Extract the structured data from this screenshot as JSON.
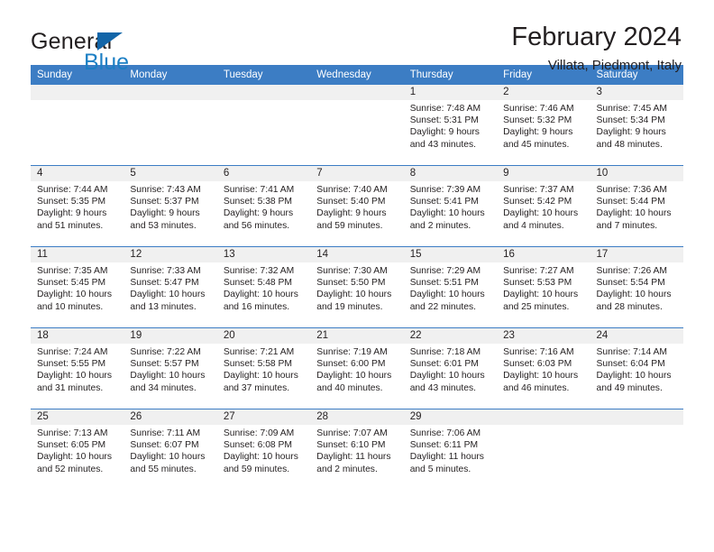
{
  "brand": {
    "name_top": "General",
    "name_bottom": "Blue"
  },
  "header": {
    "title": "February 2024",
    "location": "Villata, Piedmont, Italy"
  },
  "colors": {
    "header_blue": "#3c7dc4",
    "brand_blue": "#1c7fc4",
    "daynum_band": "#f0f0f0",
    "text": "#231f20"
  },
  "weekday_headers": [
    "Sunday",
    "Monday",
    "Tuesday",
    "Wednesday",
    "Thursday",
    "Friday",
    "Saturday"
  ],
  "weeks": [
    [
      {
        "day": "",
        "empty": true
      },
      {
        "day": "",
        "empty": true
      },
      {
        "day": "",
        "empty": true
      },
      {
        "day": "",
        "empty": true
      },
      {
        "day": "1",
        "sunrise": "Sunrise: 7:48 AM",
        "sunset": "Sunset: 5:31 PM",
        "daylight_1": "Daylight: 9 hours",
        "daylight_2": "and 43 minutes."
      },
      {
        "day": "2",
        "sunrise": "Sunrise: 7:46 AM",
        "sunset": "Sunset: 5:32 PM",
        "daylight_1": "Daylight: 9 hours",
        "daylight_2": "and 45 minutes."
      },
      {
        "day": "3",
        "sunrise": "Sunrise: 7:45 AM",
        "sunset": "Sunset: 5:34 PM",
        "daylight_1": "Daylight: 9 hours",
        "daylight_2": "and 48 minutes."
      }
    ],
    [
      {
        "day": "4",
        "sunrise": "Sunrise: 7:44 AM",
        "sunset": "Sunset: 5:35 PM",
        "daylight_1": "Daylight: 9 hours",
        "daylight_2": "and 51 minutes."
      },
      {
        "day": "5",
        "sunrise": "Sunrise: 7:43 AM",
        "sunset": "Sunset: 5:37 PM",
        "daylight_1": "Daylight: 9 hours",
        "daylight_2": "and 53 minutes."
      },
      {
        "day": "6",
        "sunrise": "Sunrise: 7:41 AM",
        "sunset": "Sunset: 5:38 PM",
        "daylight_1": "Daylight: 9 hours",
        "daylight_2": "and 56 minutes."
      },
      {
        "day": "7",
        "sunrise": "Sunrise: 7:40 AM",
        "sunset": "Sunset: 5:40 PM",
        "daylight_1": "Daylight: 9 hours",
        "daylight_2": "and 59 minutes."
      },
      {
        "day": "8",
        "sunrise": "Sunrise: 7:39 AM",
        "sunset": "Sunset: 5:41 PM",
        "daylight_1": "Daylight: 10 hours",
        "daylight_2": "and 2 minutes."
      },
      {
        "day": "9",
        "sunrise": "Sunrise: 7:37 AM",
        "sunset": "Sunset: 5:42 PM",
        "daylight_1": "Daylight: 10 hours",
        "daylight_2": "and 4 minutes."
      },
      {
        "day": "10",
        "sunrise": "Sunrise: 7:36 AM",
        "sunset": "Sunset: 5:44 PM",
        "daylight_1": "Daylight: 10 hours",
        "daylight_2": "and 7 minutes."
      }
    ],
    [
      {
        "day": "11",
        "sunrise": "Sunrise: 7:35 AM",
        "sunset": "Sunset: 5:45 PM",
        "daylight_1": "Daylight: 10 hours",
        "daylight_2": "and 10 minutes."
      },
      {
        "day": "12",
        "sunrise": "Sunrise: 7:33 AM",
        "sunset": "Sunset: 5:47 PM",
        "daylight_1": "Daylight: 10 hours",
        "daylight_2": "and 13 minutes."
      },
      {
        "day": "13",
        "sunrise": "Sunrise: 7:32 AM",
        "sunset": "Sunset: 5:48 PM",
        "daylight_1": "Daylight: 10 hours",
        "daylight_2": "and 16 minutes."
      },
      {
        "day": "14",
        "sunrise": "Sunrise: 7:30 AM",
        "sunset": "Sunset: 5:50 PM",
        "daylight_1": "Daylight: 10 hours",
        "daylight_2": "and 19 minutes."
      },
      {
        "day": "15",
        "sunrise": "Sunrise: 7:29 AM",
        "sunset": "Sunset: 5:51 PM",
        "daylight_1": "Daylight: 10 hours",
        "daylight_2": "and 22 minutes."
      },
      {
        "day": "16",
        "sunrise": "Sunrise: 7:27 AM",
        "sunset": "Sunset: 5:53 PM",
        "daylight_1": "Daylight: 10 hours",
        "daylight_2": "and 25 minutes."
      },
      {
        "day": "17",
        "sunrise": "Sunrise: 7:26 AM",
        "sunset": "Sunset: 5:54 PM",
        "daylight_1": "Daylight: 10 hours",
        "daylight_2": "and 28 minutes."
      }
    ],
    [
      {
        "day": "18",
        "sunrise": "Sunrise: 7:24 AM",
        "sunset": "Sunset: 5:55 PM",
        "daylight_1": "Daylight: 10 hours",
        "daylight_2": "and 31 minutes."
      },
      {
        "day": "19",
        "sunrise": "Sunrise: 7:22 AM",
        "sunset": "Sunset: 5:57 PM",
        "daylight_1": "Daylight: 10 hours",
        "daylight_2": "and 34 minutes."
      },
      {
        "day": "20",
        "sunrise": "Sunrise: 7:21 AM",
        "sunset": "Sunset: 5:58 PM",
        "daylight_1": "Daylight: 10 hours",
        "daylight_2": "and 37 minutes."
      },
      {
        "day": "21",
        "sunrise": "Sunrise: 7:19 AM",
        "sunset": "Sunset: 6:00 PM",
        "daylight_1": "Daylight: 10 hours",
        "daylight_2": "and 40 minutes."
      },
      {
        "day": "22",
        "sunrise": "Sunrise: 7:18 AM",
        "sunset": "Sunset: 6:01 PM",
        "daylight_1": "Daylight: 10 hours",
        "daylight_2": "and 43 minutes."
      },
      {
        "day": "23",
        "sunrise": "Sunrise: 7:16 AM",
        "sunset": "Sunset: 6:03 PM",
        "daylight_1": "Daylight: 10 hours",
        "daylight_2": "and 46 minutes."
      },
      {
        "day": "24",
        "sunrise": "Sunrise: 7:14 AM",
        "sunset": "Sunset: 6:04 PM",
        "daylight_1": "Daylight: 10 hours",
        "daylight_2": "and 49 minutes."
      }
    ],
    [
      {
        "day": "25",
        "sunrise": "Sunrise: 7:13 AM",
        "sunset": "Sunset: 6:05 PM",
        "daylight_1": "Daylight: 10 hours",
        "daylight_2": "and 52 minutes."
      },
      {
        "day": "26",
        "sunrise": "Sunrise: 7:11 AM",
        "sunset": "Sunset: 6:07 PM",
        "daylight_1": "Daylight: 10 hours",
        "daylight_2": "and 55 minutes."
      },
      {
        "day": "27",
        "sunrise": "Sunrise: 7:09 AM",
        "sunset": "Sunset: 6:08 PM",
        "daylight_1": "Daylight: 10 hours",
        "daylight_2": "and 59 minutes."
      },
      {
        "day": "28",
        "sunrise": "Sunrise: 7:07 AM",
        "sunset": "Sunset: 6:10 PM",
        "daylight_1": "Daylight: 11 hours",
        "daylight_2": "and 2 minutes."
      },
      {
        "day": "29",
        "sunrise": "Sunrise: 7:06 AM",
        "sunset": "Sunset: 6:11 PM",
        "daylight_1": "Daylight: 11 hours",
        "daylight_2": "and 5 minutes."
      },
      {
        "day": "",
        "empty": true
      },
      {
        "day": "",
        "empty": true
      }
    ]
  ]
}
